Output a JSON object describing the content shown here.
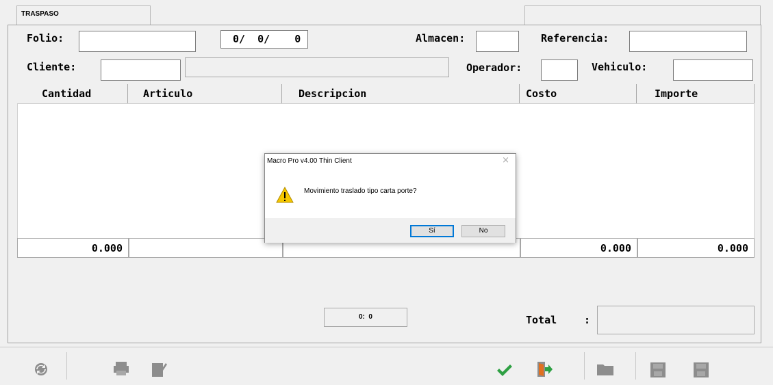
{
  "tab": {
    "title": "TRASPASO"
  },
  "form": {
    "folio_label": "Folio:",
    "folio_value": "",
    "date_text": "0/  0/    0",
    "almacen_label": "Almacen:",
    "referencia_label": "Referencia:",
    "cliente_label": "Cliente:",
    "operador_label": "Operador:",
    "vehiculo_label": "Vehiculo:"
  },
  "grid": {
    "columns": [
      "Cantidad",
      "Articulo",
      "Descripcion",
      "Costo",
      "Importe"
    ],
    "totals": {
      "cantidad": "0.000",
      "costo": "0.000",
      "importe": "0.000"
    }
  },
  "footer": {
    "counter": "0:  0",
    "total_label": "Total",
    "total_colon": ":"
  },
  "dialog": {
    "title": "Macro Pro v4.00 Thin Client",
    "close": "×",
    "message": "Movimiento traslado tipo carta porte?",
    "yes_label": "Sí",
    "no_label": "No"
  },
  "toolbar": {
    "icons": [
      "refresh-icon",
      "print-icon",
      "edit-icon",
      "check-icon",
      "exit-door-icon",
      "folder-icon",
      "save-icon",
      "disk-icon"
    ]
  },
  "colors": {
    "accept_green": "#2ea043",
    "door_orange": "#e07020",
    "dialog_focus": "#0078d7"
  }
}
